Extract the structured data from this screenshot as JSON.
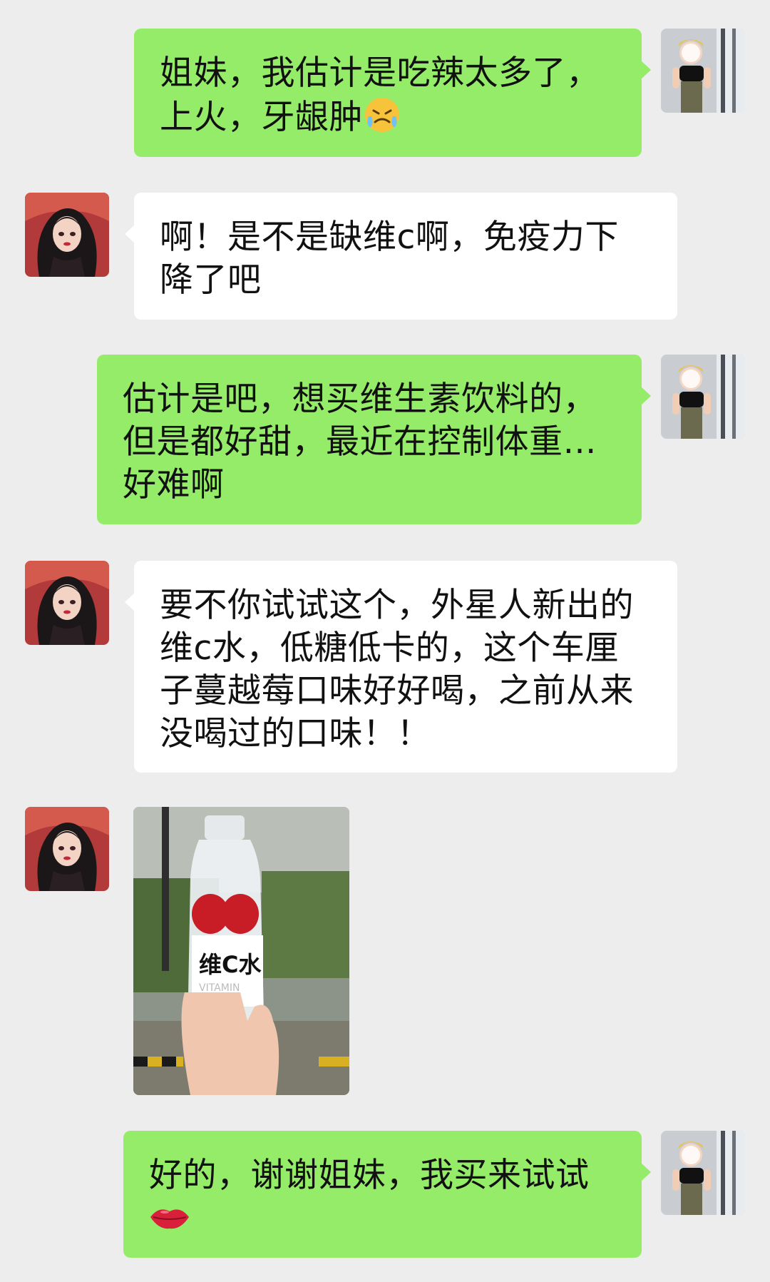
{
  "messages": [
    {
      "side": "right",
      "avatar": "self-avatar",
      "text": "姐妹，我估计是吃辣太多了，上火，牙龈肿",
      "emoji": "crying-face-emoji"
    },
    {
      "side": "left",
      "avatar": "friend-avatar",
      "text": "啊！是不是缺维c啊，免疫力下降了吧"
    },
    {
      "side": "right",
      "avatar": "self-avatar",
      "text": "估计是吧，想买维生素饮料的，但是都好甜，最近在控制体重…好难啊"
    },
    {
      "side": "left",
      "avatar": "friend-avatar",
      "text": "要不你试试这个，外星人新出的维c水，低糖低卡的，这个车厘子蔓越莓口味好好喝，之前从来没喝过的口味！！"
    },
    {
      "side": "left",
      "avatar": "friend-avatar",
      "type": "image",
      "image_label": "维C水"
    },
    {
      "side": "right",
      "avatar": "self-avatar",
      "text": "好的，谢谢姐妹，我买来试试",
      "emoji": "lips-emoji"
    }
  ],
  "colors": {
    "background": "#ededed",
    "sent_bubble": "#95ec69",
    "received_bubble": "#ffffff"
  }
}
